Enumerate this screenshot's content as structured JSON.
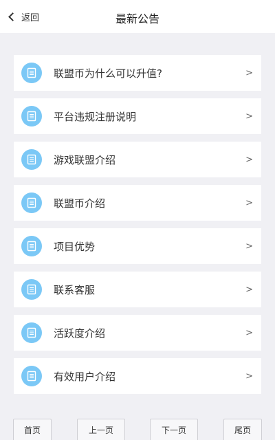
{
  "header": {
    "back_label": "返回",
    "title": "最新公告"
  },
  "notices": [
    {
      "label": "联盟币为什么可以升值?",
      "arrow": ">",
      "icon": "document-icon"
    },
    {
      "label": "平台违规注册说明",
      "arrow": ">",
      "icon": "document-icon"
    },
    {
      "label": "游戏联盟介绍",
      "arrow": ">",
      "icon": "document-icon"
    },
    {
      "label": "联盟币介绍",
      "arrow": ">",
      "icon": "document-icon"
    },
    {
      "label": "项目优势",
      "arrow": ">",
      "icon": "document-icon"
    },
    {
      "label": "联系客服",
      "arrow": ">",
      "icon": "document-icon"
    },
    {
      "label": "活跃度介绍",
      "arrow": ">",
      "icon": "document-icon"
    },
    {
      "label": "有效用户介绍",
      "arrow": ">",
      "icon": "document-icon"
    }
  ],
  "pagination": {
    "first": "首页",
    "prev": "上一页",
    "next": "下一页",
    "last": "尾页"
  },
  "colors": {
    "background": "#f0f0f4",
    "icon_circle": "#7bc8f6",
    "card": "#ffffff"
  }
}
